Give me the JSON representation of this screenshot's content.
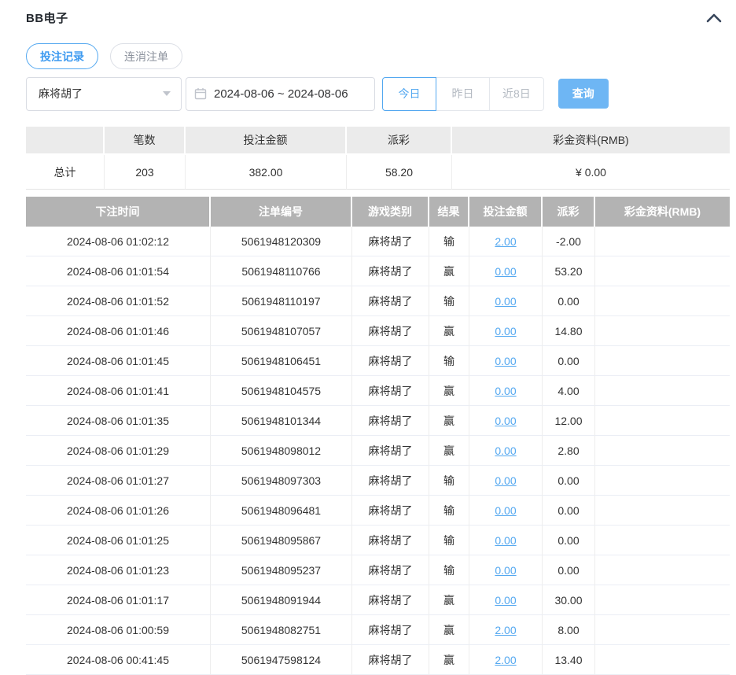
{
  "panel": {
    "title": "BB电子",
    "collapse_icon": "chevron-up",
    "accent_color": "#54a8f0",
    "negative_color": "#ec6b6b",
    "table_header_bg": "#b3b3b3"
  },
  "tabs": [
    {
      "label": "投注记录",
      "active": true
    },
    {
      "label": "连消注单",
      "active": false
    }
  ],
  "filters": {
    "game_select": {
      "value": "麻将胡了"
    },
    "date_range": "2024-08-06 ~ 2024-08-06",
    "quick_buttons": [
      {
        "label": "今日",
        "active": true
      },
      {
        "label": "昨日",
        "active": false
      },
      {
        "label": "近8日",
        "active": false
      }
    ],
    "search_label": "查询"
  },
  "summary": {
    "headers": [
      "",
      "笔数",
      "投注金额",
      "派彩",
      "彩金资料(RMB)"
    ],
    "row": {
      "label": "总计",
      "count": "203",
      "bet_amount": "382.00",
      "payout": "58.20",
      "bonus": "¥ 0.00"
    }
  },
  "table": {
    "headers": [
      "下注时间",
      "注单编号",
      "游戏类别",
      "结果",
      "投注金额",
      "派彩",
      "彩金资料(RMB)"
    ],
    "rows": [
      [
        "2024-08-06 01:02:12",
        "5061948120309",
        "麻将胡了",
        "输",
        "2.00",
        "-2.00",
        ""
      ],
      [
        "2024-08-06 01:01:54",
        "5061948110766",
        "麻将胡了",
        "赢",
        "0.00",
        "53.20",
        ""
      ],
      [
        "2024-08-06 01:01:52",
        "5061948110197",
        "麻将胡了",
        "输",
        "0.00",
        "0.00",
        ""
      ],
      [
        "2024-08-06 01:01:46",
        "5061948107057",
        "麻将胡了",
        "赢",
        "0.00",
        "14.80",
        ""
      ],
      [
        "2024-08-06 01:01:45",
        "5061948106451",
        "麻将胡了",
        "输",
        "0.00",
        "0.00",
        ""
      ],
      [
        "2024-08-06 01:01:41",
        "5061948104575",
        "麻将胡了",
        "赢",
        "0.00",
        "4.00",
        ""
      ],
      [
        "2024-08-06 01:01:35",
        "5061948101344",
        "麻将胡了",
        "赢",
        "0.00",
        "12.00",
        ""
      ],
      [
        "2024-08-06 01:01:29",
        "5061948098012",
        "麻将胡了",
        "赢",
        "0.00",
        "2.80",
        ""
      ],
      [
        "2024-08-06 01:01:27",
        "5061948097303",
        "麻将胡了",
        "输",
        "0.00",
        "0.00",
        ""
      ],
      [
        "2024-08-06 01:01:26",
        "5061948096481",
        "麻将胡了",
        "输",
        "0.00",
        "0.00",
        ""
      ],
      [
        "2024-08-06 01:01:25",
        "5061948095867",
        "麻将胡了",
        "输",
        "0.00",
        "0.00",
        ""
      ],
      [
        "2024-08-06 01:01:23",
        "5061948095237",
        "麻将胡了",
        "输",
        "0.00",
        "0.00",
        ""
      ],
      [
        "2024-08-06 01:01:17",
        "5061948091944",
        "麻将胡了",
        "赢",
        "0.00",
        "30.00",
        ""
      ],
      [
        "2024-08-06 01:00:59",
        "5061948082751",
        "麻将胡了",
        "赢",
        "2.00",
        "8.00",
        ""
      ],
      [
        "2024-08-06 00:41:45",
        "5061947598124",
        "麻将胡了",
        "赢",
        "2.00",
        "13.40",
        ""
      ]
    ]
  }
}
